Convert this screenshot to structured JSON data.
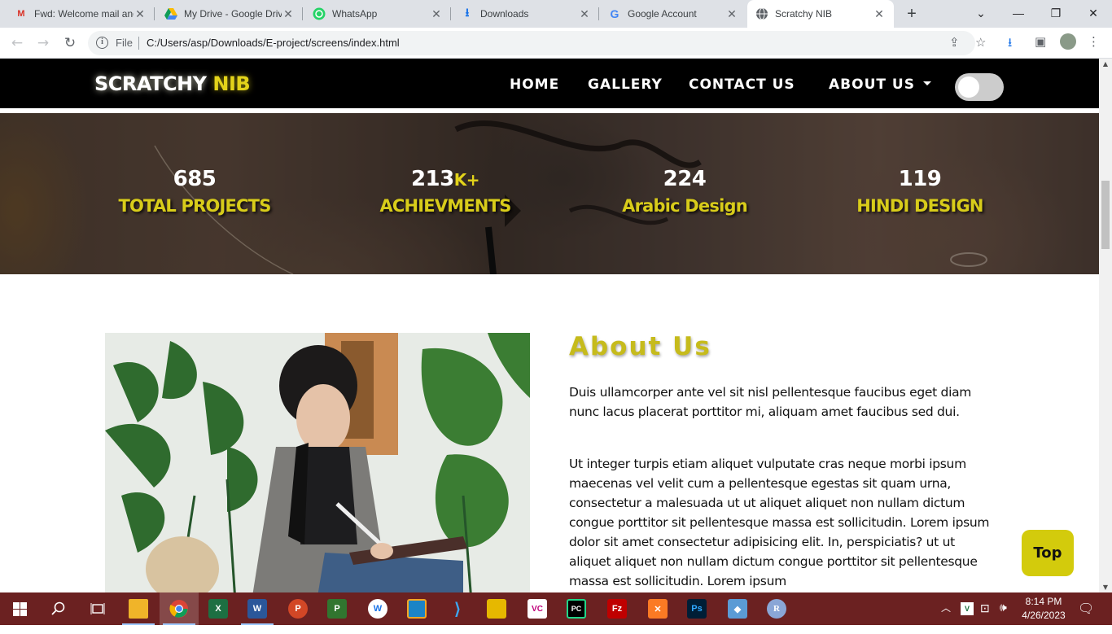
{
  "browser": {
    "tabs": [
      {
        "title": "Fwd: Welcome mail and",
        "icon": "gmail-icon"
      },
      {
        "title": "My Drive - Google Drive",
        "icon": "google-drive-icon"
      },
      {
        "title": "WhatsApp",
        "icon": "whatsapp-icon"
      },
      {
        "title": "Downloads",
        "icon": "download-icon"
      },
      {
        "title": "Google Account",
        "icon": "google-icon"
      },
      {
        "title": "Scratchy NIB",
        "icon": "globe-icon"
      }
    ],
    "active_tab": 5,
    "address": {
      "scheme_label": "File",
      "url": "C:/Users/asp/Downloads/E-project/screens/index.html"
    }
  },
  "site": {
    "brand": {
      "part1": "SCRATCHY",
      "part2": "NIB"
    },
    "nav": {
      "home": "HOME",
      "gallery": "GALLERY",
      "contact": "CONTACT US",
      "about": "ABOUT US"
    },
    "theme_toggle_on": false,
    "stats": [
      {
        "number": "685",
        "suffix": "",
        "label": "TOTAL PROJECTS"
      },
      {
        "number": "213",
        "suffix": "K+",
        "label": "ACHIEVMENTS"
      },
      {
        "number": "224",
        "suffix": "",
        "label": "Arabic Design"
      },
      {
        "number": "119",
        "suffix": "",
        "label": "HINDI DESIGN"
      }
    ],
    "about": {
      "title": "About Us",
      "paragraph1": "Duis ullamcorper ante vel sit nisl pellentesque faucibus eget diam nunc lacus placerat porttitor mi, aliquam amet faucibus sed dui.",
      "paragraph2": "Ut integer turpis etiam aliquet vulputate cras neque morbi ipsum maecenas vel velit cum a pellentesque egestas sit quam urna, consectetur a malesuada ut ut aliquet aliquet non nullam dictum congue porttitor sit pellentesque massa est sollicitudin. Lorem ipsum dolor sit amet consectetur adipisicing elit. In, perspiciatis? ut ut aliquet aliquet non nullam dictum congue porttitor sit pellentesque massa est sollicitudin. Lorem ipsum"
    },
    "top_button": "Top"
  },
  "taskbar": {
    "apps": [
      "file-explorer-icon",
      "chrome-icon",
      "excel-icon",
      "word-icon",
      "powerpoint-icon",
      "project-icon",
      "app-icon",
      "virtualbox-icon",
      "vscode-icon",
      "app-icon",
      "vc-icon",
      "pycharm-icon",
      "filezilla-icon",
      "xampp-icon",
      "photoshop-icon",
      "3d-box-icon",
      "r-icon"
    ],
    "clock": {
      "time": "8:14 PM",
      "date": "4/26/2023"
    }
  },
  "colors": {
    "accent_yellow": "#d3cb0c",
    "nav_bg": "#000000",
    "taskbar_bg": "#6b2121"
  }
}
